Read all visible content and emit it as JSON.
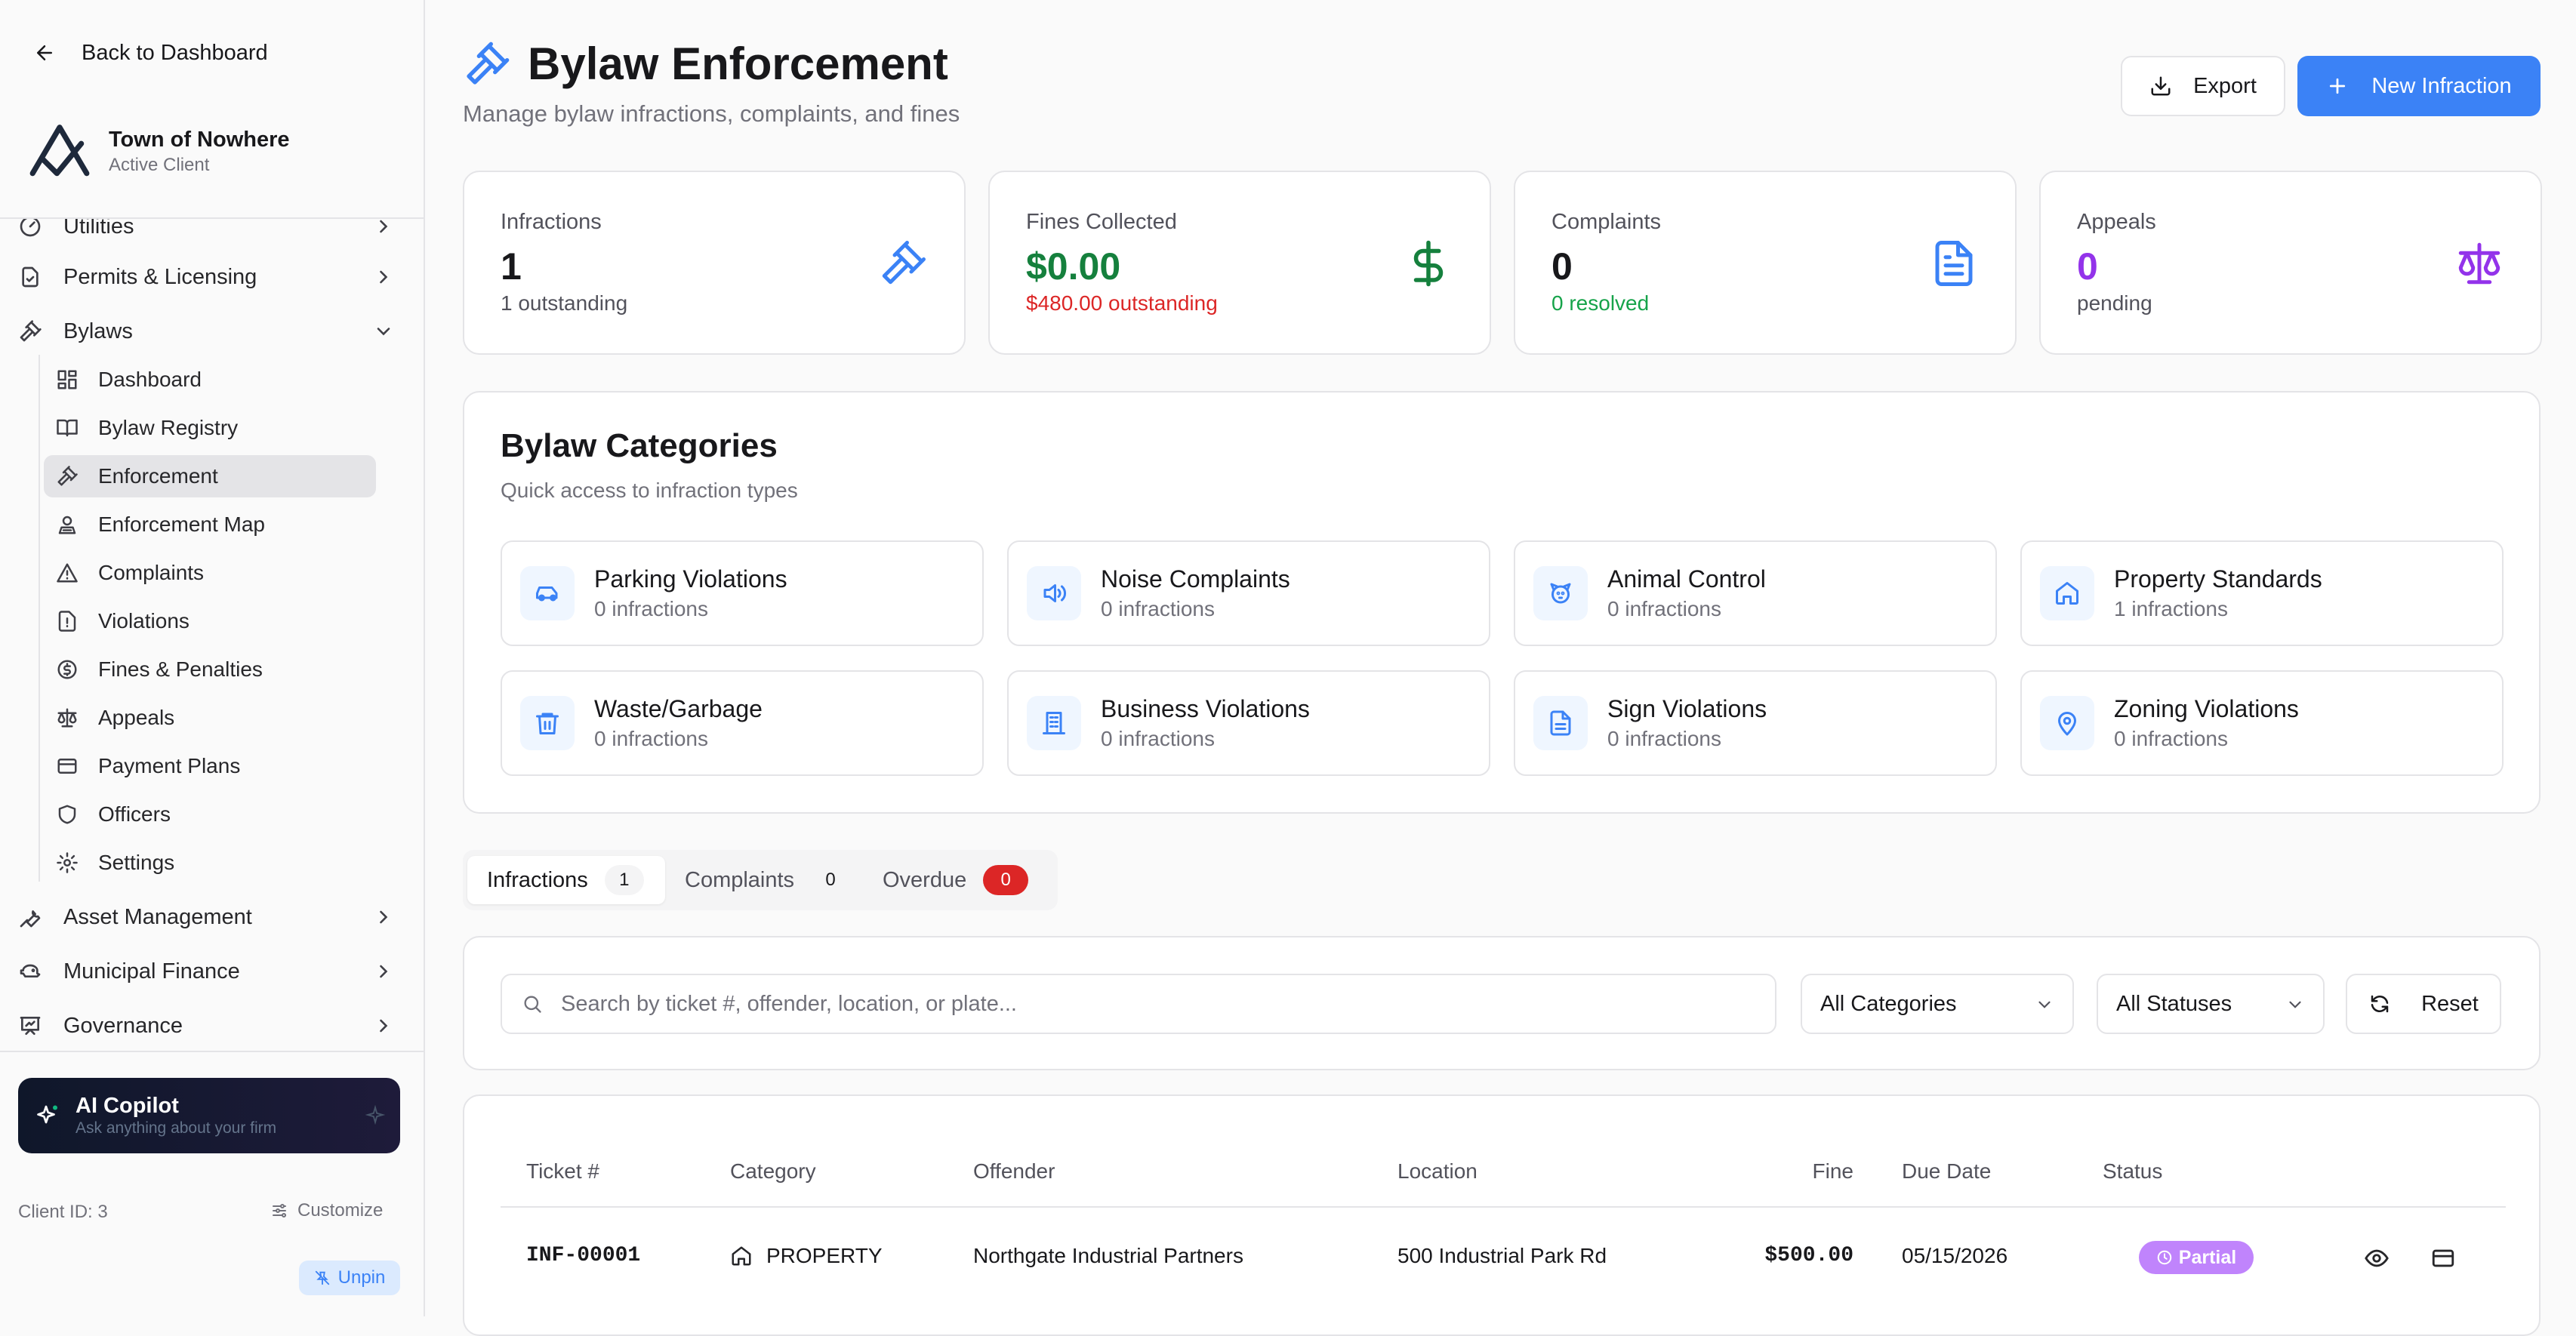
{
  "sidebar": {
    "back_label": "Back to Dashboard",
    "client_name": "Town of Nowhere",
    "client_status": "Active Client",
    "nav": [
      {
        "label": "Utilities"
      },
      {
        "label": "Permits & Licensing"
      },
      {
        "label": "Bylaws"
      },
      {
        "label": "Asset Management"
      },
      {
        "label": "Municipal Finance"
      },
      {
        "label": "Governance"
      }
    ],
    "bylaw_items": [
      {
        "label": "Dashboard",
        "icon": "grid-icon"
      },
      {
        "label": "Bylaw Registry",
        "icon": "book-icon"
      },
      {
        "label": "Enforcement",
        "icon": "gavel-icon",
        "active": true
      },
      {
        "label": "Enforcement Map",
        "icon": "map-user-icon"
      },
      {
        "label": "Complaints",
        "icon": "alert-triangle-icon"
      },
      {
        "label": "Violations",
        "icon": "alert-file-icon"
      },
      {
        "label": "Fines & Penalties",
        "icon": "dollar-circle-icon"
      },
      {
        "label": "Appeals",
        "icon": "scale-icon"
      },
      {
        "label": "Payment Plans",
        "icon": "credit-card-icon"
      },
      {
        "label": "Officers",
        "icon": "shield-icon"
      },
      {
        "label": "Settings",
        "icon": "gear-icon"
      }
    ],
    "copilot_title": "AI Copilot",
    "copilot_sub": "Ask anything about your firm",
    "client_id": "Client ID: 3",
    "customize_label": "Customize",
    "unpin_label": "Unpin"
  },
  "header": {
    "title": "Bylaw Enforcement",
    "subtitle": "Manage bylaw infractions, complaints, and fines",
    "export_label": "Export",
    "new_label": "New Infraction"
  },
  "stats": [
    {
      "label": "Infractions",
      "value": "1",
      "sub": "1 outstanding",
      "value_color": "#18181b",
      "sub_color": "#52525b",
      "icon": "gavel-icon",
      "icon_color": "#3b82f6"
    },
    {
      "label": "Fines Collected",
      "value": "$0.00",
      "sub": "$480.00 outstanding",
      "value_color": "#15803d",
      "sub_color": "#dc2626",
      "icon": "dollar-icon",
      "icon_color": "#15803d"
    },
    {
      "label": "Complaints",
      "value": "0",
      "sub": "0 resolved",
      "value_color": "#18181b",
      "sub_color": "#16a34a",
      "icon": "file-text-icon",
      "icon_color": "#3b82f6"
    },
    {
      "label": "Appeals",
      "value": "0",
      "sub": "pending",
      "value_color": "#9333ea",
      "sub_color": "#52525b",
      "icon": "scale-icon",
      "icon_color": "#9333ea"
    }
  ],
  "categories": {
    "title": "Bylaw Categories",
    "subtitle": "Quick access to infraction types",
    "items": [
      {
        "name": "Parking Violations",
        "count": "0 infractions",
        "icon": "car-icon"
      },
      {
        "name": "Noise Complaints",
        "count": "0 infractions",
        "icon": "volume-icon"
      },
      {
        "name": "Animal Control",
        "count": "0 infractions",
        "icon": "dog-icon"
      },
      {
        "name": "Property Standards",
        "count": "1 infractions",
        "icon": "home-icon"
      },
      {
        "name": "Waste/Garbage",
        "count": "0 infractions",
        "icon": "trash-icon"
      },
      {
        "name": "Business Violations",
        "count": "0 infractions",
        "icon": "building-icon"
      },
      {
        "name": "Sign Violations",
        "count": "0 infractions",
        "icon": "file-text-icon"
      },
      {
        "name": "Zoning Violations",
        "count": "0 infractions",
        "icon": "map-pin-icon"
      }
    ]
  },
  "tabs": [
    {
      "label": "Infractions",
      "count": "1"
    },
    {
      "label": "Complaints",
      "count": "0"
    },
    {
      "label": "Overdue",
      "count": "0"
    }
  ],
  "filters": {
    "search_placeholder": "Search by ticket #, offender, location, or plate...",
    "category": "All Categories",
    "status": "All Statuses",
    "reset_label": "Reset"
  },
  "table": {
    "headers": [
      "Ticket #",
      "Category",
      "Offender",
      "Location",
      "Fine",
      "Due Date",
      "Status"
    ],
    "rows": [
      {
        "ticket": "INF-00001",
        "category": "PROPERTY",
        "offender": "Northgate Industrial Partners",
        "location": "500 Industrial Park Rd",
        "fine": "$500.00",
        "due": "05/15/2026",
        "status": "Partial"
      }
    ]
  },
  "colors": {
    "accent": "#3b82f6",
    "partial": "#c084fc",
    "overdue": "#dc2626"
  }
}
